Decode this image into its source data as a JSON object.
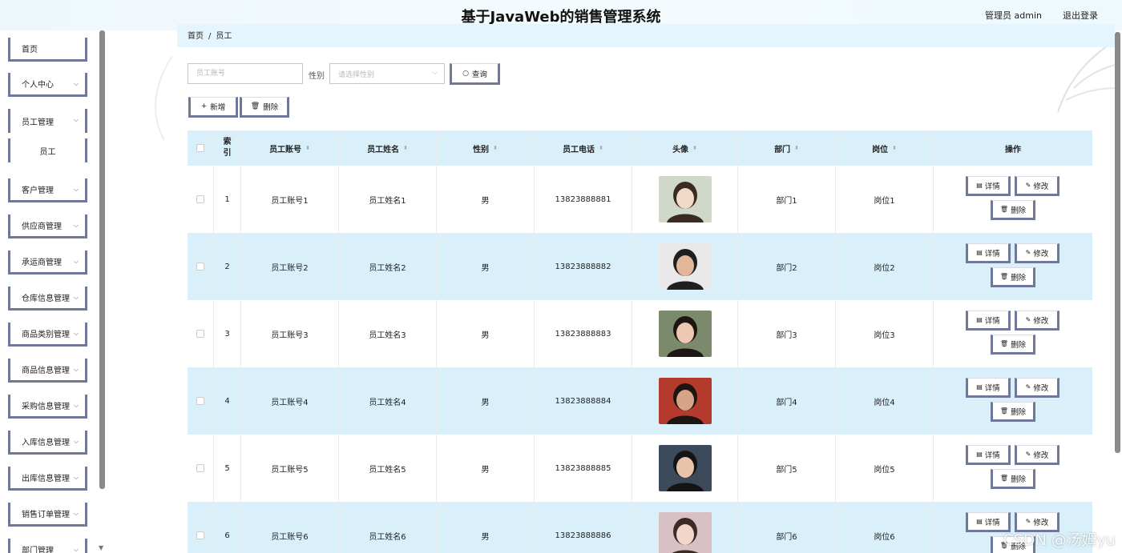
{
  "header": {
    "title": "基于JavaWeb的销售管理系统",
    "user": "管理员 admin",
    "logout": "退出登录"
  },
  "sidebar": {
    "items": [
      {
        "label": "首页",
        "expandable": false
      },
      {
        "label": "个人中心",
        "expandable": true
      },
      {
        "label": "员工管理",
        "expandable": true
      },
      {
        "label": "员工",
        "sub": true
      },
      {
        "label": "客户管理",
        "expandable": true
      },
      {
        "label": "供应商管理",
        "expandable": true
      },
      {
        "label": "承运商管理",
        "expandable": true
      },
      {
        "label": "仓库信息管理",
        "expandable": true
      },
      {
        "label": "商品类别管理",
        "expandable": true
      },
      {
        "label": "商品信息管理",
        "expandable": true
      },
      {
        "label": "采购信息管理",
        "expandable": true
      },
      {
        "label": "入库信息管理",
        "expandable": true
      },
      {
        "label": "出库信息管理",
        "expandable": true
      },
      {
        "label": "销售订单管理",
        "expandable": true
      },
      {
        "label": "部门管理",
        "expandable": true
      }
    ]
  },
  "breadcrumb": {
    "home": "首页",
    "sep": "/",
    "current": "员工"
  },
  "search": {
    "account_placeholder": "员工账号",
    "gender_label": "性别",
    "gender_placeholder": "请选择性别",
    "query_label": "查询",
    "add_label": "新增",
    "delete_label": "删除"
  },
  "table": {
    "headers": {
      "index": "索引",
      "account": "员工账号",
      "name": "员工姓名",
      "gender": "性别",
      "phone": "员工电话",
      "avatar": "头像",
      "dept": "部门",
      "post": "岗位",
      "ops": "操作"
    },
    "ops": {
      "detail": "详情",
      "edit": "修改",
      "delete": "删除"
    },
    "rows": [
      {
        "index": "1",
        "account": "员工账号1",
        "name": "员工姓名1",
        "gender": "男",
        "phone": "13823888881",
        "dept": "部门1",
        "post": "岗位1"
      },
      {
        "index": "2",
        "account": "员工账号2",
        "name": "员工姓名2",
        "gender": "男",
        "phone": "13823888882",
        "dept": "部门2",
        "post": "岗位2"
      },
      {
        "index": "3",
        "account": "员工账号3",
        "name": "员工姓名3",
        "gender": "男",
        "phone": "13823888883",
        "dept": "部门3",
        "post": "岗位3"
      },
      {
        "index": "4",
        "account": "员工账号4",
        "name": "员工姓名4",
        "gender": "男",
        "phone": "13823888884",
        "dept": "部门4",
        "post": "岗位4"
      },
      {
        "index": "5",
        "account": "员工账号5",
        "name": "员工姓名5",
        "gender": "男",
        "phone": "13823888885",
        "dept": "部门5",
        "post": "岗位5"
      },
      {
        "index": "6",
        "account": "员工账号6",
        "name": "员工姓名6",
        "gender": "男",
        "phone": "13823888886",
        "dept": "部门6",
        "post": "岗位6"
      }
    ]
  },
  "watermark": "CSDN @汤姆yu",
  "colors": {
    "accent_border": "#6f7898",
    "header_bg": "#d9f0fb",
    "row_alt": "#d9f0fb"
  }
}
